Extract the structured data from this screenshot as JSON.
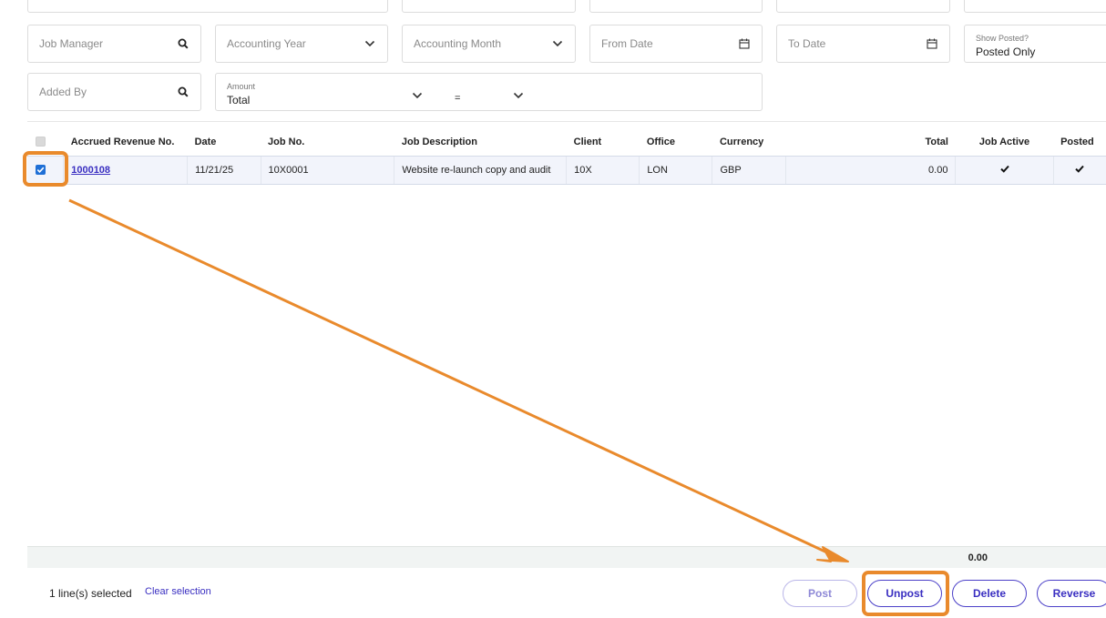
{
  "filters": {
    "job_manager": {
      "placeholder": "Job Manager",
      "icon": "search-icon"
    },
    "accounting_year": {
      "placeholder": "Accounting Year",
      "icon": "chevron-down-icon"
    },
    "accounting_month": {
      "placeholder": "Accounting Month",
      "icon": "chevron-down-icon"
    },
    "from_date": {
      "placeholder": "From Date",
      "icon": "calendar-icon"
    },
    "to_date": {
      "placeholder": "To Date",
      "icon": "calendar-icon"
    },
    "show_posted": {
      "label": "Show Posted?",
      "value": "Posted Only"
    },
    "added_by": {
      "placeholder": "Added By",
      "icon": "search-icon"
    },
    "amount": {
      "label": "Amount",
      "value": "Total",
      "operator": "="
    }
  },
  "table": {
    "columns": [
      "Accrued Revenue No.",
      "Date",
      "Job No.",
      "Job Description",
      "Client",
      "Office",
      "Currency",
      "Total",
      "Job Active",
      "Posted"
    ],
    "rows": [
      {
        "checked": true,
        "accrued_revenue_no": "1000108",
        "date": "11/21/25",
        "job_no": "10X0001",
        "job_description": "Website re-launch copy and audit",
        "client": "10X",
        "office": "LON",
        "currency": "GBP",
        "total": "0.00",
        "job_active": true,
        "posted": true
      }
    ]
  },
  "footer": {
    "total": "0.00",
    "selection_text": "1 line(s) selected",
    "clear_selection": "Clear selection"
  },
  "actions": {
    "post": "Post",
    "unpost": "Unpost",
    "delete": "Delete",
    "reverse": "Reverse"
  },
  "colors": {
    "accent": "#3a2fc1",
    "highlight": "#e98a2c",
    "checkbox": "#1f6fd6",
    "row_selected": "#f2f4fb"
  }
}
